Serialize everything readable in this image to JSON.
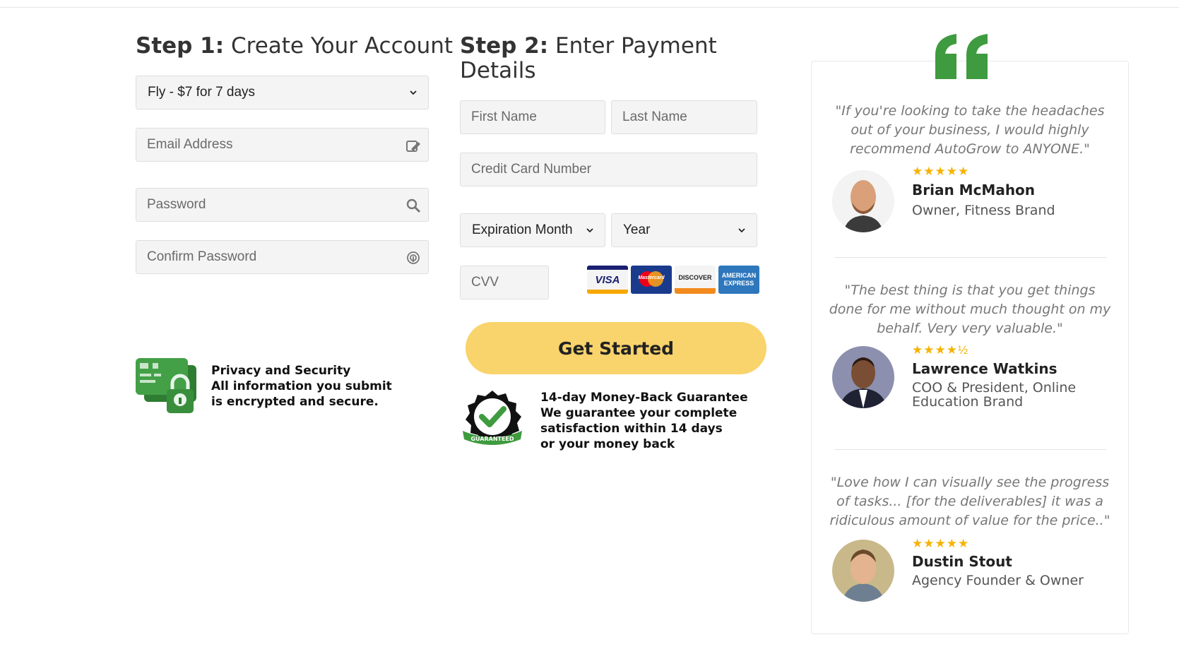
{
  "step1": {
    "heading_bold": "Step 1:",
    "heading_rest": " Create Your Account",
    "plan_select": "Fly - $7 for 7 days",
    "email_placeholder": "Email Address",
    "password_placeholder": "Password",
    "confirm_placeholder": "Confirm Password"
  },
  "step2": {
    "heading_bold": "Step 2:",
    "heading_rest": " Enter Payment Details",
    "first_name_placeholder": "First Name",
    "last_name_placeholder": "Last Name",
    "card_placeholder": "Credit Card Number",
    "exp_month": "Expiration Month",
    "exp_year": "Year",
    "cvv_placeholder": "CVV",
    "card_logos": [
      "VISA",
      "Mastercard",
      "DISCOVER",
      "AMERICAN EXPRESS"
    ],
    "cta_label": "Get Started"
  },
  "privacy": {
    "title": "Privacy and Security",
    "line1": "All information you submit",
    "line2": "is encrypted and secure."
  },
  "guarantee": {
    "seal_text": "GUARANTEED",
    "title": "14-day Money-Back Guarantee",
    "line1": "We guarantee your complete",
    "line2": "satisfaction within 14 days",
    "line3": "or your money back"
  },
  "testimonials": [
    {
      "quote": "\"If you're looking to take the headaches out of your business, I would highly recommend AutoGrow to ANYONE.\"",
      "rating": 5,
      "stars": "★★★★★",
      "name": "Brian McMahon",
      "role": "Owner, Fitness Brand"
    },
    {
      "quote": "\"The best thing is that you get things done for me without much thought on my behalf. Very very valuable.\"",
      "rating": 4.5,
      "stars": "★★★★½",
      "name": "Lawrence Watkins",
      "role": "COO & President, Online Education Brand"
    },
    {
      "quote": "\"Love how I can visually see the progress of tasks... [for the deliverables] it was a ridiculous amount of value for the price..\"",
      "rating": 5,
      "stars": "★★★★★",
      "name": "Dustin Stout",
      "role": "Agency Founder & Owner"
    }
  ],
  "colors": {
    "cta": "#f9d36b",
    "accent_green": "#3f9b3f",
    "star": "#f5b301"
  }
}
